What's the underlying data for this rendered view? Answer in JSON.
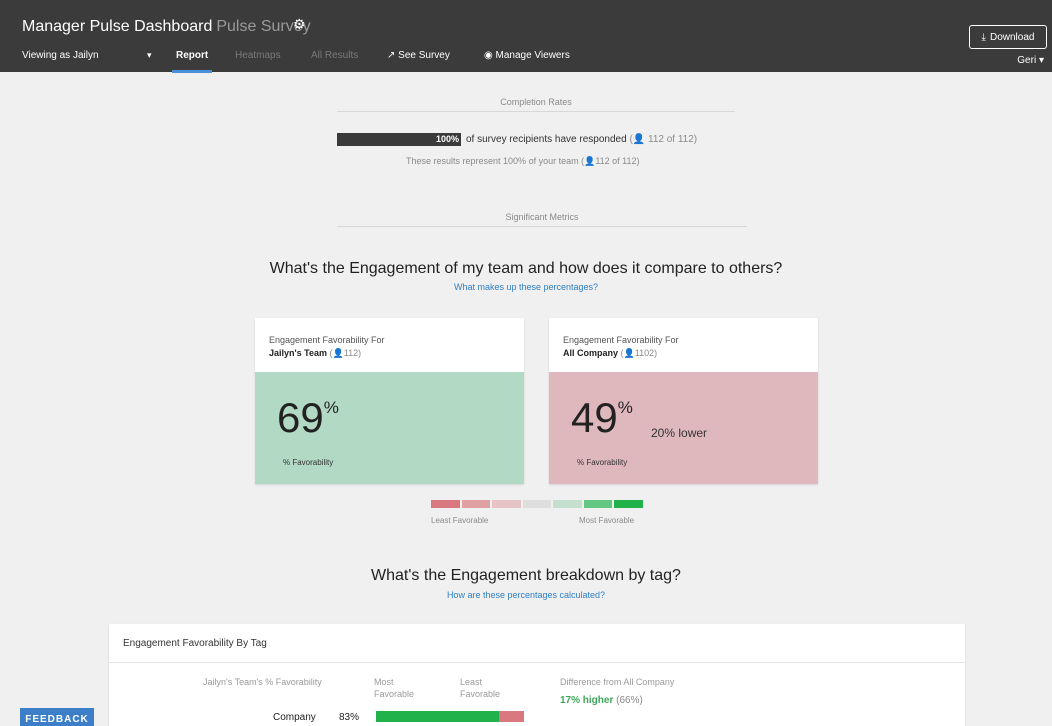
{
  "header": {
    "title": "Manager Pulse Dashboard",
    "subtitle": "Pulse Survey",
    "gear_icon": "gear-icon",
    "download_label": "Download",
    "user": "Geri"
  },
  "nav": {
    "viewing_as": "Viewing as Jailyn",
    "report": "Report",
    "heatmaps": "Heatmaps",
    "all_results": "All Results",
    "see_survey": "See Survey",
    "manage_viewers": "Manage Viewers"
  },
  "completion": {
    "section_label": "Completion Rates",
    "percent_text": "100%",
    "progress_fraction": 1.0,
    "responded_text": "of survey recipients have responded",
    "responded_count": "112 of 112",
    "team_text": "These results represent 100% of your team",
    "team_count": "112 of 112"
  },
  "metrics": {
    "section_label": "Significant Metrics",
    "question": "What's the Engagement of my team and how does it compare to others?",
    "link": "What makes up these percentages?",
    "team_card": {
      "heading": "Engagement Favorability For",
      "name": "Jailyn's Team",
      "count": "112",
      "value": "69",
      "unit": "%",
      "label": "% Favorability",
      "color": "#b2d9c4"
    },
    "company_card": {
      "heading": "Engagement Favorability For",
      "name": "All Company",
      "count": "1102",
      "value": "49",
      "unit": "%",
      "comparison": "20% lower",
      "label": "% Favorability",
      "color": "#dfb8bd"
    },
    "legend": {
      "colors": [
        "#d9787e",
        "#e0a0a4",
        "#e8c3c5",
        "#dedede",
        "#c5e0cf",
        "#63c784",
        "#22b24c"
      ],
      "least": "Least Favorable",
      "most": "Most Favorable"
    }
  },
  "breakdown": {
    "question": "What's the Engagement breakdown by tag?",
    "link": "How are these percentages calculated?",
    "card_title": "Engagement Favorability By Tag",
    "col_team": "Jailyn's Team's % Favorability",
    "col_most": "Most\nFavorable",
    "col_least": "Least\nFavorable",
    "col_diff": "Difference from All Company",
    "rows": [
      {
        "name": "Company",
        "value": "83%",
        "favorable_fraction": 0.83,
        "diff": "17% higher",
        "company_value": "(66%)"
      }
    ]
  },
  "feedback": "FEEDBACK"
}
